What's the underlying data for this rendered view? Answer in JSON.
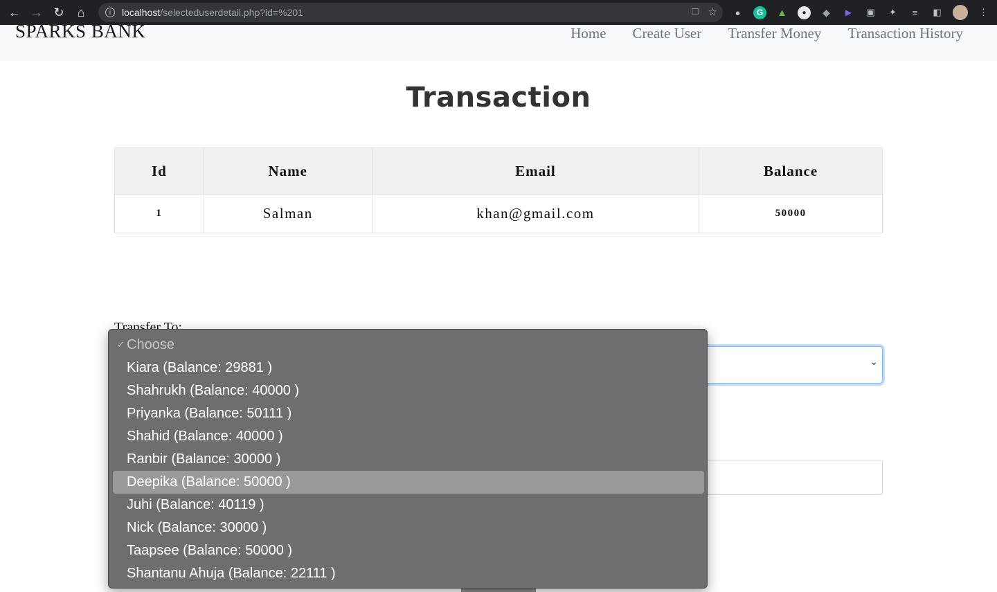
{
  "browser": {
    "url_host": "localhost",
    "url_path": "/selecteduserdetail.php?id=%201",
    "icons": [
      "back-icon",
      "forward-icon",
      "reload-icon",
      "home-icon",
      "info-icon",
      "share-icon",
      "star-icon",
      "extensions-icon",
      "profile-avatar"
    ]
  },
  "nav": {
    "brand": "SPARKS BANK",
    "links": [
      "Home",
      "Create User",
      "Transfer Money",
      "Transaction History"
    ]
  },
  "page": {
    "title": "Transaction"
  },
  "table": {
    "headers": [
      "Id",
      "Name",
      "Email",
      "Balance"
    ],
    "rows": [
      [
        "1",
        "Salman",
        "khan@gmail.com",
        "50000"
      ]
    ]
  },
  "form": {
    "transfer_label": "Transfer To:"
  },
  "dropdown": {
    "placeholder": "Choose",
    "options": [
      "Kiara (Balance: 29881 )",
      "Shahrukh (Balance: 40000 )",
      "Priyanka (Balance: 50111 )",
      "Shahid (Balance: 40000 )",
      "Ranbir (Balance: 30000 )",
      "Deepika (Balance: 50000 )",
      "Juhi (Balance: 40119 )",
      "Nick (Balance: 30000 )",
      "Taapsee (Balance: 50000 )",
      "Shantanu Ahuja (Balance: 22111 )"
    ],
    "highlighted": "Deepika (Balance: 50000 )",
    "colors": {
      "menu_bg": "#6e6e71",
      "highlight": "#99999c",
      "focus_ring": "#80bdff"
    }
  }
}
